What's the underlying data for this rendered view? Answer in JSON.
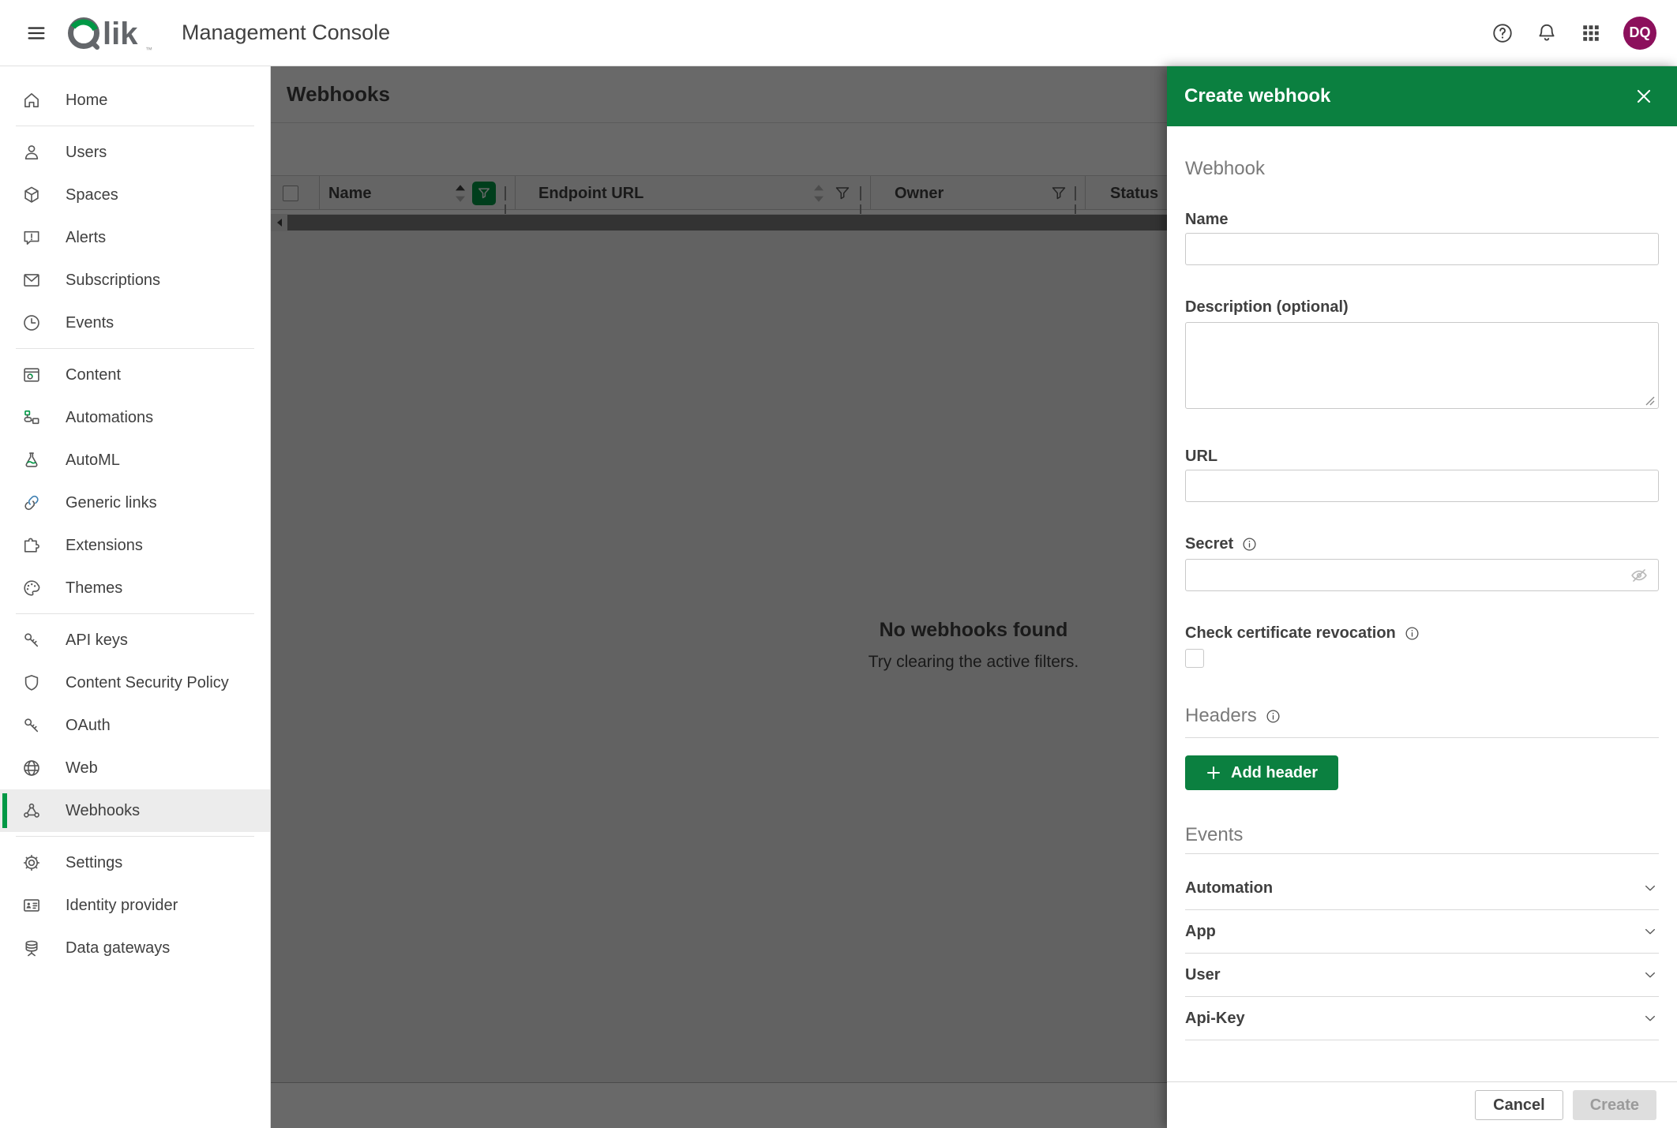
{
  "topbar": {
    "title": "Management Console",
    "avatar_initials": "DQ"
  },
  "sidebar": {
    "items": [
      "Home",
      "Users",
      "Spaces",
      "Alerts",
      "Subscriptions",
      "Events",
      "Content",
      "Automations",
      "AutoML",
      "Generic links",
      "Extensions",
      "Themes",
      "API keys",
      "Content Security Policy",
      "OAuth",
      "Web",
      "Webhooks",
      "Settings",
      "Identity provider",
      "Data gateways"
    ],
    "selected": "Webhooks"
  },
  "main": {
    "page_title": "Webhooks",
    "table": {
      "columns": [
        "Name",
        "Endpoint URL",
        "Owner",
        "Status"
      ],
      "sort": {
        "column": "Name",
        "direction": "asc"
      },
      "filter_active_column": "Name"
    },
    "empty_state": {
      "title": "No webhooks found",
      "subtitle": "Try clearing the active filters."
    }
  },
  "panel": {
    "title": "Create webhook",
    "section_webhook": "Webhook",
    "name_label": "Name",
    "description_label": "Description (optional)",
    "url_label": "URL",
    "secret_label": "Secret",
    "check_certificate_label": "Check certificate revocation",
    "headers_label": "Headers",
    "add_header_label": "Add header",
    "section_events": "Events",
    "events": [
      "Automation",
      "App",
      "User",
      "Api-Key"
    ],
    "cancel_label": "Cancel",
    "create_label": "Create"
  },
  "colors": {
    "brand_green": "#009845",
    "panel_header_green": "#0b8040",
    "avatar_bg": "#8c105c",
    "content_overlay": "rgba(0,0,0,0.59)"
  }
}
